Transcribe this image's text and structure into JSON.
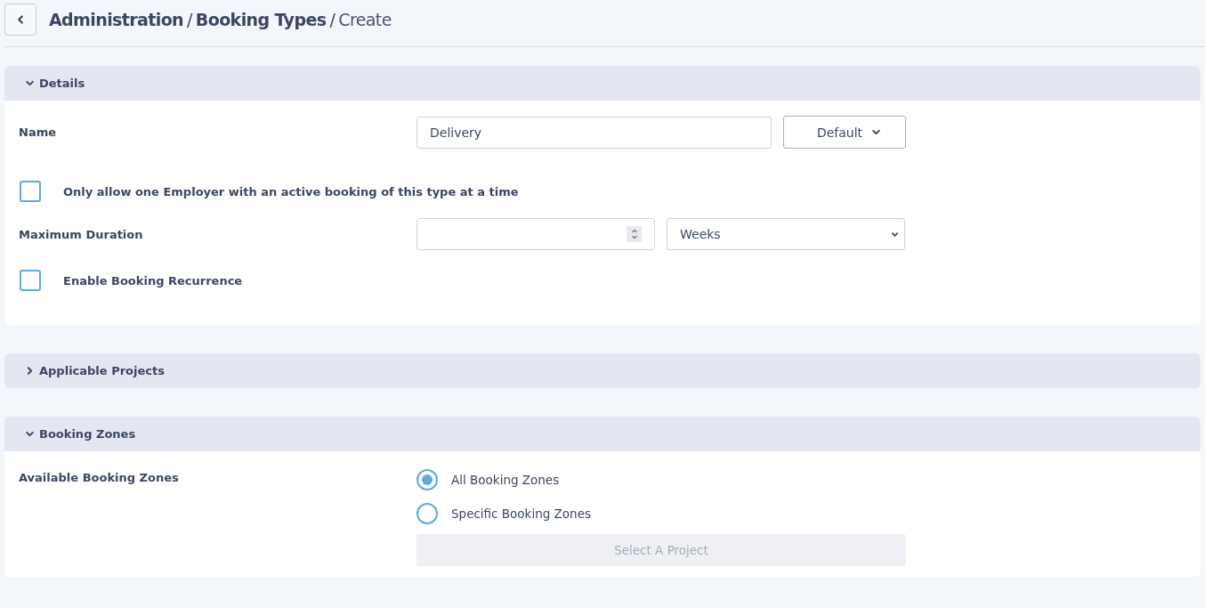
{
  "breadcrumb": [
    {
      "kind": "link",
      "label": "Administration"
    },
    {
      "kind": "separator",
      "label": "/"
    },
    {
      "kind": "link",
      "label": "Booking Types"
    },
    {
      "kind": "separator",
      "label": "/"
    },
    {
      "kind": "current",
      "label": "Create"
    }
  ],
  "sections": [
    {
      "title": "Details",
      "expanded": true,
      "rows": [
        {
          "kind": "text",
          "label": "Name",
          "value": "Delivery",
          "button": "Default"
        },
        {
          "kind": "checkbox",
          "label": "Only allow one Employer with an active booking of this type at a time",
          "checked": false
        },
        {
          "kind": "duration",
          "label": "Maximum Duration",
          "unit": "Weeks"
        },
        {
          "kind": "checkbox",
          "label": "Enable Booking Recurrence",
          "checked": false
        }
      ]
    },
    {
      "title": "Applicable Projects",
      "expanded": false
    },
    {
      "title": "Booking Zones",
      "expanded": true,
      "rows": [
        {
          "kind": "radio",
          "label": "Available Booking Zones",
          "options": [
            {
              "label": "All Booking Zones",
              "selected": true
            },
            {
              "label": "Specific Booking Zones",
              "selected": false
            }
          ],
          "button": {
            "label": "Select A Project",
            "disabled": true
          }
        }
      ]
    }
  ]
}
